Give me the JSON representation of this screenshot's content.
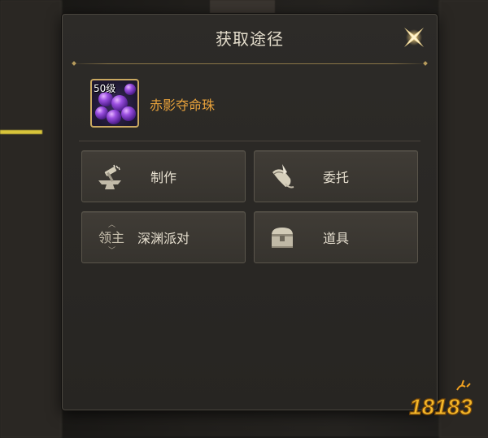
{
  "dialog": {
    "title": "获取途径",
    "close_icon": "close-x-icon"
  },
  "item": {
    "level": "50级",
    "name": "赤影夺命珠",
    "icon": "purple-orbs-icon"
  },
  "sources": [
    {
      "label": "制作",
      "icon": "anvil-hammer-icon"
    },
    {
      "label": "委托",
      "icon": "scroll-quill-icon"
    },
    {
      "label": "深渊派对",
      "icon": "lingzhu-badge-icon",
      "badge_text": "领主"
    },
    {
      "label": "道具",
      "icon": "treasure-chest-icon"
    }
  ],
  "watermark": {
    "text": "18183"
  },
  "colors": {
    "accent_gold": "#c9a860",
    "item_name": "#e8a23b",
    "title_text": "#e4ddcc"
  }
}
